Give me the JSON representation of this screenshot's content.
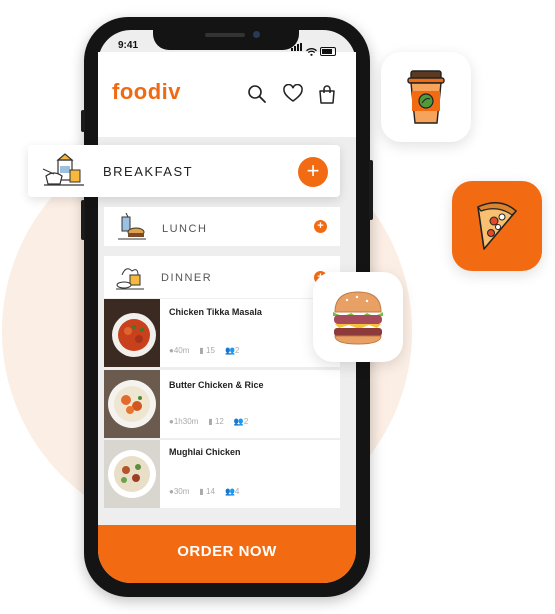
{
  "status": {
    "time": "9:41"
  },
  "app": {
    "brand": "foodiv"
  },
  "categories": [
    {
      "label": "BREAKFAST"
    },
    {
      "label": "LUNCH"
    },
    {
      "label": "DINNER"
    }
  ],
  "recipes": [
    {
      "title": "Chicken Tikka Masala",
      "time": "40m",
      "count": "15",
      "people": "2"
    },
    {
      "title": "Butter Chicken & Rice",
      "time": "1h30m",
      "count": "12",
      "people": "2"
    },
    {
      "title": "Mughlai Chicken",
      "time": "30m",
      "count": "14",
      "people": "4"
    }
  ],
  "cta": {
    "label": "ORDER NOW"
  },
  "icons": {
    "header": [
      "search-icon",
      "heart-icon",
      "shopping-bag-icon"
    ],
    "floating": [
      "coffee-cup-icon",
      "pizza-slice-icon",
      "burger-icon"
    ]
  },
  "colors": {
    "accent": "#f26b12",
    "background_circle": "#fbeee4"
  }
}
